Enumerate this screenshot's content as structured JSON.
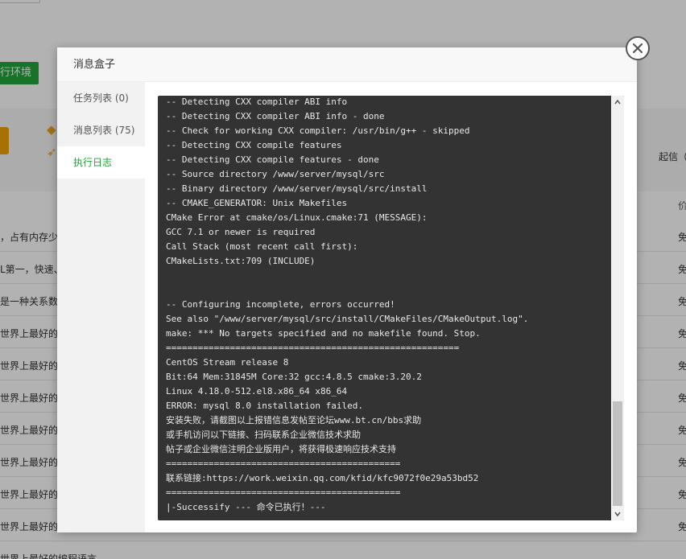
{
  "background": {
    "green_button_label": "行环境",
    "right_text": "起信（年付）",
    "column_head": "价",
    "rows": [
      {
        "left": "，占有内存少，",
        "right": "免"
      },
      {
        "left": "L第一，快速、",
        "right": "免"
      },
      {
        "left": "是一种关系数",
        "right": "免"
      },
      {
        "left": "世界上最好的编",
        "right": "免"
      },
      {
        "left": "世界上最好的编",
        "right": "免"
      },
      {
        "left": "世界上最好的编",
        "right": "免"
      },
      {
        "left": "世界上最好的编",
        "right": "免"
      },
      {
        "left": "世界上最好的编",
        "right": "免"
      },
      {
        "left": "世界上最好的编",
        "right": "免"
      },
      {
        "left": "世界上最好的编",
        "right": "免"
      },
      {
        "left": "世界上最好的编程语言",
        "right": ""
      }
    ]
  },
  "modal": {
    "title": "消息盒子",
    "close_icon": "close-icon",
    "tabs": [
      {
        "label": "任务列表 (0)",
        "active": false
      },
      {
        "label": "消息列表 (75)",
        "active": false
      },
      {
        "label": "执行日志",
        "active": true
      }
    ],
    "log_lines": [
      "-- Detecting CXX compiler ABI info",
      "-- Detecting CXX compiler ABI info - done",
      "-- Check for working CXX compiler: /usr/bin/g++ - skipped",
      "-- Detecting CXX compile features",
      "-- Detecting CXX compile features - done",
      "-- Source directory /www/server/mysql/src",
      "-- Binary directory /www/server/mysql/src/install",
      "-- CMAKE_GENERATOR: Unix Makefiles",
      "CMake Error at cmake/os/Linux.cmake:71 (MESSAGE):",
      "GCC 7.1 or newer is required",
      "Call Stack (most recent call first):",
      "CMakeLists.txt:709 (INCLUDE)",
      "",
      "",
      "-- Configuring incomplete, errors occurred!",
      "See also \"/www/server/mysql/src/install/CMakeFiles/CMakeOutput.log\".",
      "make: *** No targets specified and no makefile found. Stop.",
      "=======================================================",
      "CentOS Stream release 8",
      "Bit:64 Mem:31845M Core:32 gcc:4.8.5 cmake:3.20.2",
      "Linux 4.18.0-512.el8.x86_64 x86_64",
      "ERROR: mysql 8.0 installation failed.",
      "安装失败，请截图以上报错信息发帖至论坛www.bt.cn/bbs求助",
      "或手机访问以下链接、扫码联系企业微信技术求助",
      "帖子或企业微信注明企业版用户，将获得极速响应技术支持",
      "============================================",
      "联系链接:https://work.weixin.qq.com/kfid/kfc9072f0e29a53bd52",
      "============================================",
      "|-Successify --- 命令已执行！---"
    ]
  },
  "colors": {
    "accent_green": "#20a53a",
    "log_background": "#333333",
    "log_text": "#e8e8e8"
  }
}
